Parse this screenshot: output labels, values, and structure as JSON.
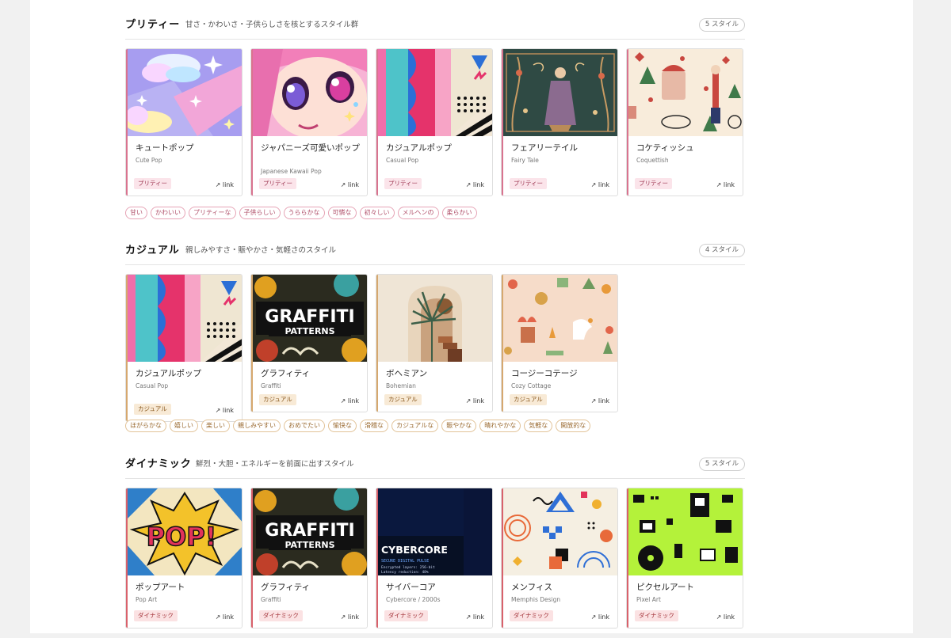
{
  "sections": [
    {
      "title": "プリティー",
      "description": "甘さ・かわいさ・子供らしさを核とするスタイル群",
      "count": "5 スタイル",
      "cards": [
        {
          "jp": "キュートポップ",
          "en": "Cute Pop",
          "category": "プリティー",
          "link": "↗ link",
          "thumb": "cute-pop-illustration"
        },
        {
          "jp": "ジャパニーズ可愛いポップ",
          "en": "Japanese Kawaii Pop",
          "category": "プリティー",
          "link": "↗ link",
          "thumb": "kawaii-anime-eye-illustration"
        },
        {
          "jp": "カジュアルポップ",
          "en": "Casual Pop",
          "category": "プリティー",
          "link": "↗ link",
          "thumb": "casual-pop-pattern"
        },
        {
          "jp": "フェアリーテイル",
          "en": "Fairy Tale",
          "category": "プリティー",
          "link": "↗ link",
          "thumb": "fairy-tale-tapestry"
        },
        {
          "jp": "コケティッシュ",
          "en": "Coquettish",
          "category": "プリティー",
          "link": "↗ link",
          "thumb": "coquettish-pattern"
        }
      ],
      "tags": [
        "甘い",
        "かわいい",
        "プリティーな",
        "子供らしい",
        "うららかな",
        "可憐な",
        "初々しい",
        "メルヘンの",
        "柔らかい"
      ]
    },
    {
      "title": "カジュアル",
      "description": "親しみやすさ・賑やかさ・気軽さのスタイル",
      "count": "4 スタイル",
      "cards": [
        {
          "jp": "カジュアルポップ",
          "en": "Casual Pop",
          "category": "カジュアル",
          "link": "↗ link",
          "thumb": "casual-pop-pattern"
        },
        {
          "jp": "グラフィティ",
          "en": "Graffiti",
          "category": "カジュアル",
          "link": "↗ link",
          "thumb": "graffiti-patterns",
          "thumb_text": [
            "GRAFFITI",
            "PATTERNS"
          ]
        },
        {
          "jp": "ボヘミアン",
          "en": "Bohemian",
          "category": "カジュアル",
          "link": "↗ link",
          "thumb": "bohemian-arch-palm"
        },
        {
          "jp": "コージーコテージ",
          "en": "Cozy Cottage",
          "category": "カジュアル",
          "link": "↗ link",
          "thumb": "cozy-cottage-pattern"
        }
      ],
      "tags": [
        "ほがらかな",
        "嬉しい",
        "楽しい",
        "親しみやすい",
        "おめでたい",
        "愉快な",
        "滑稽な",
        "カジュアルな",
        "賑やかな",
        "晴れやかな",
        "気軽な",
        "開放的な"
      ]
    },
    {
      "title": "ダイナミック",
      "description": "鮮烈・大胆・エネルギーを前面に出すスタイル",
      "count": "5 スタイル",
      "cards": [
        {
          "jp": "ポップアート",
          "en": "Pop Art",
          "category": "ダイナミック",
          "link": "↗ link",
          "thumb": "pop-art-comic",
          "thumb_text": [
            "POP!"
          ]
        },
        {
          "jp": "グラフィティ",
          "en": "Graffiti",
          "category": "ダイナミック",
          "link": "↗ link",
          "thumb": "graffiti-patterns",
          "thumb_text": [
            "GRAFFITI",
            "PATTERNS"
          ]
        },
        {
          "jp": "サイバーコア",
          "en": "Cybercore / 2000s",
          "category": "ダイナミック",
          "link": "↗ link",
          "thumb": "cybercore-screen",
          "thumb_text": [
            "CYBERCORE",
            "SECURE DIGITAL PULSE",
            "Encrypted layers: 256-bit",
            "Latency reduction: 48%"
          ]
        },
        {
          "jp": "メンフィス",
          "en": "Memphis Design",
          "category": "ダイナミック",
          "link": "↗ link",
          "thumb": "memphis-shapes"
        },
        {
          "jp": "ピクセルアート",
          "en": "Pixel Art",
          "category": "ダイナミック",
          "link": "↗ link",
          "thumb": "pixel-art-icons"
        }
      ]
    }
  ]
}
